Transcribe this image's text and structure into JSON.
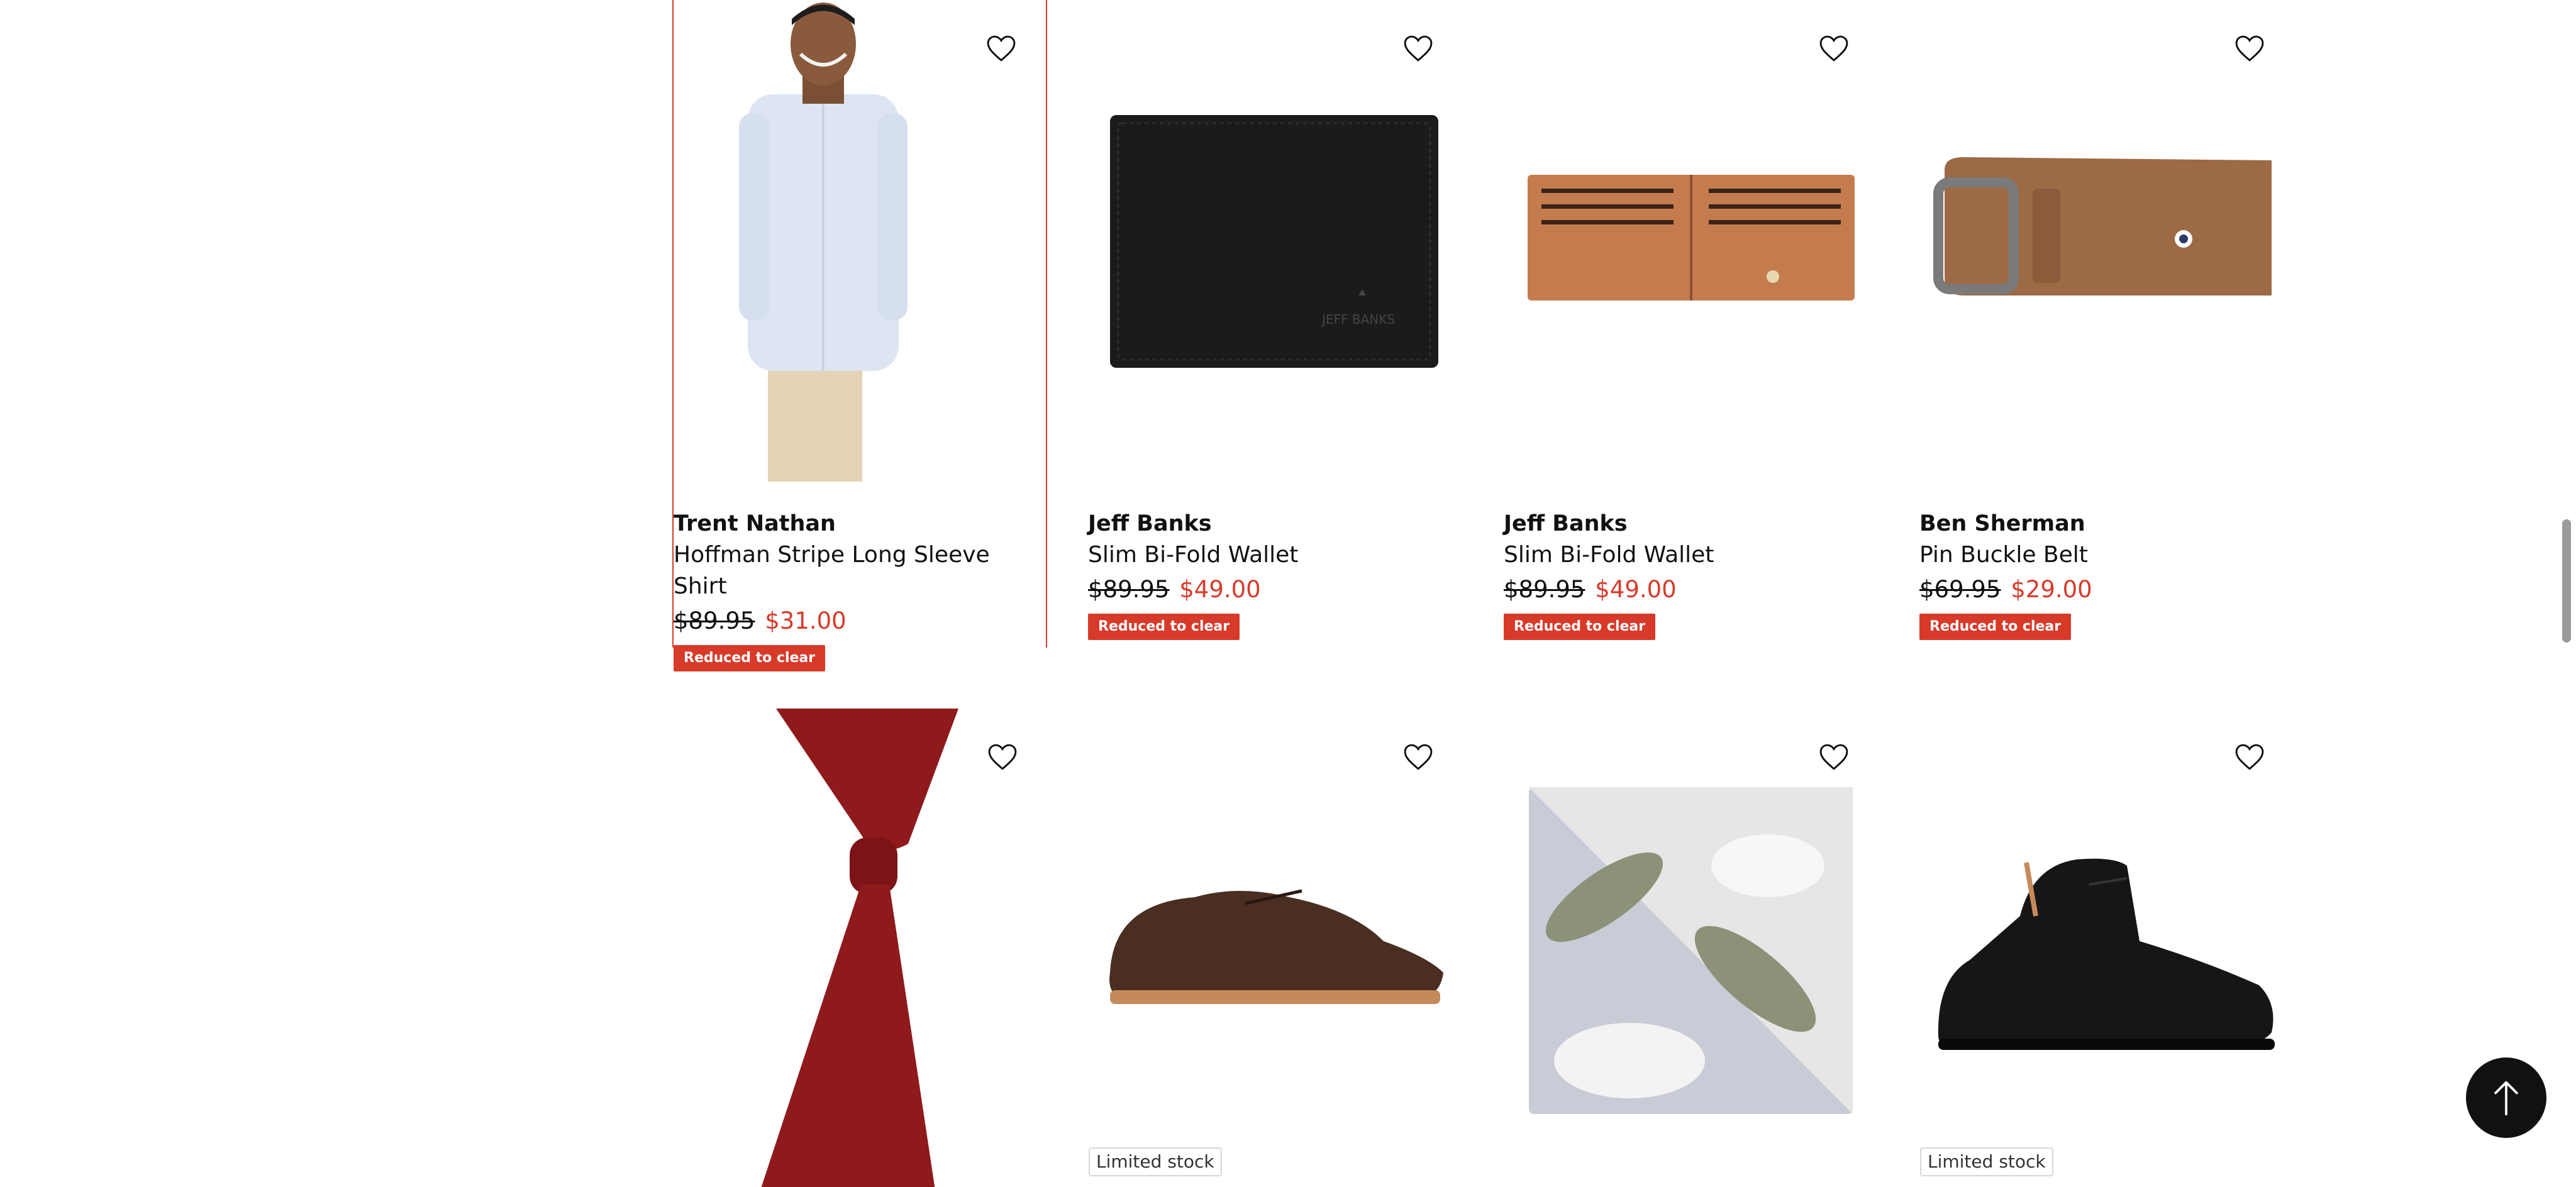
{
  "products": [
    {
      "brand": "Trent Nathan",
      "name": "Hoffman Stripe Long Sleeve Shirt",
      "was": "$89.95",
      "now": "$31.00",
      "badge": "Reduced to clear",
      "image": "man-in-light-blue-shirt",
      "wishlist_icon": "heart-outline-icon"
    },
    {
      "brand": "Jeff Banks",
      "name": "Slim Bi-Fold Wallet",
      "was": "$89.95",
      "now": "$49.00",
      "badge": "Reduced to clear",
      "image": "black-wallet",
      "imprint": "JEFF BANKS",
      "wishlist_icon": "heart-outline-icon"
    },
    {
      "brand": "Jeff Banks",
      "name": "Slim Bi-Fold Wallet",
      "was": "$89.95",
      "now": "$49.00",
      "badge": "Reduced to clear",
      "image": "tan-open-wallet",
      "wishlist_icon": "heart-outline-icon"
    },
    {
      "brand": "Ben Sherman",
      "name": "Pin Buckle Belt",
      "was": "$69.95",
      "now": "$29.00",
      "badge": "Reduced to clear",
      "image": "brown-suede-belt",
      "wishlist_icon": "heart-outline-icon"
    },
    {
      "image": "red-knit-tie",
      "wishlist_icon": "heart-outline-icon"
    },
    {
      "image": "brown-derby-shoe",
      "stock_label": "Limited stock",
      "wishlist_icon": "heart-outline-icon"
    },
    {
      "image": "floral-pocket-square",
      "wishlist_icon": "heart-outline-icon"
    },
    {
      "image": "black-chukka-boot",
      "stock_label": "Limited stock",
      "wishlist_icon": "heart-outline-icon"
    }
  ],
  "colors": {
    "sale_red": "#d83a2a",
    "text": "#111111",
    "back_to_top_bg": "#111111"
  },
  "back_to_top_icon": "arrow-up-icon"
}
